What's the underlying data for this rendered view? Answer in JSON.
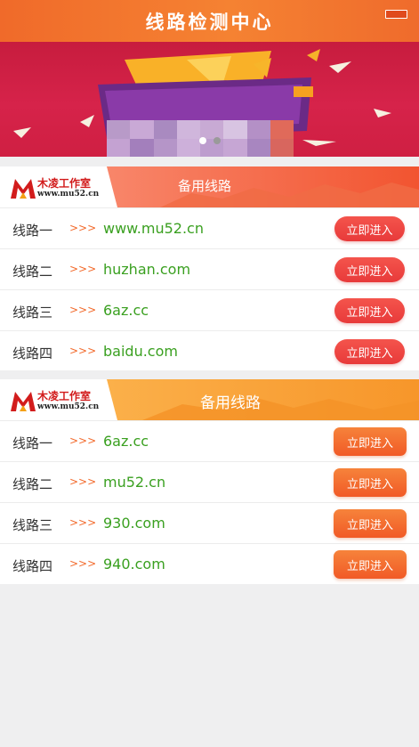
{
  "header": {
    "title": "线路检测中心"
  },
  "banner": {
    "slide_count": 2,
    "active_slide": 1
  },
  "brand": {
    "name": "木凌工作室",
    "url": "www.mu52.cn"
  },
  "sections": [
    {
      "title": "备用线路",
      "rows": [
        {
          "label": "线路一",
          "arrows": ">>>",
          "url": "www.mu52.cn",
          "button": "立即进入"
        },
        {
          "label": "线路二",
          "arrows": ">>>",
          "url": "huzhan.com",
          "button": "立即进入"
        },
        {
          "label": "线路三",
          "arrows": ">>>",
          "url": "6az.cc",
          "button": "立即进入"
        },
        {
          "label": "线路四",
          "arrows": ">>>",
          "url": "baidu.com",
          "button": "立即进入"
        }
      ]
    },
    {
      "title": "备用线路",
      "rows": [
        {
          "label": "线路一",
          "arrows": ">>>",
          "url": "6az.cc",
          "button": "立即进入"
        },
        {
          "label": "线路二",
          "arrows": ">>>",
          "url": "mu52.cn",
          "button": "立即进入"
        },
        {
          "label": "线路三",
          "arrows": ">>>",
          "url": "930.com",
          "button": "立即进入"
        },
        {
          "label": "线路四",
          "arrows": ">>>",
          "url": "940.com",
          "button": "立即进入"
        }
      ]
    }
  ],
  "colors": {
    "header": "#f06a2a",
    "url_text": "#3aa020",
    "arrows": "#f26a2c",
    "button_red": "#f04848",
    "button_orange": "#f26a2c"
  }
}
